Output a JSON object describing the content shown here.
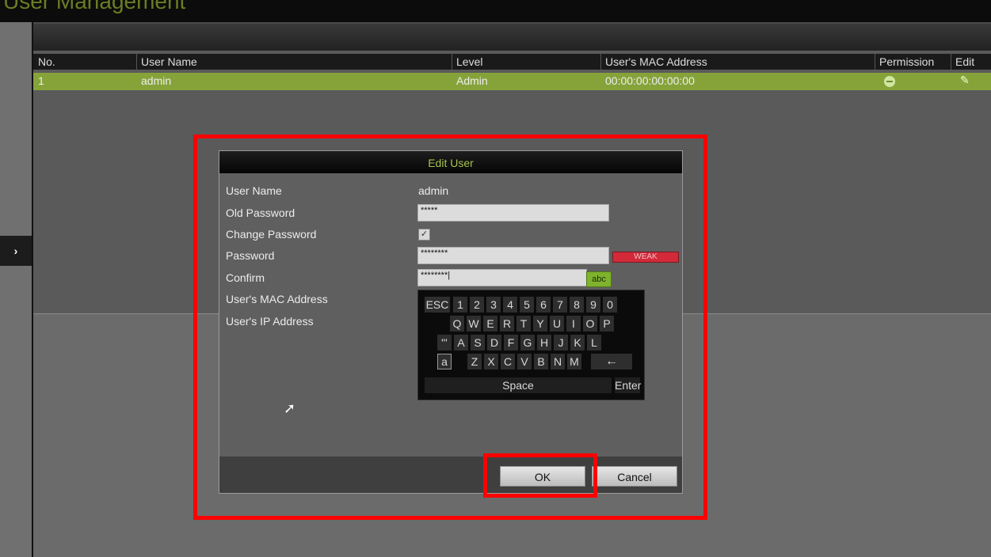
{
  "window": {
    "title": "User Management"
  },
  "sidebar": {
    "collapse_label": "›"
  },
  "table": {
    "headers": {
      "no": "No.",
      "user_name": "User Name",
      "level": "Level",
      "mac": "User's MAC Address",
      "permission": "Permission",
      "edit": "Edit"
    },
    "rows": [
      {
        "no": "1",
        "user_name": "admin",
        "level": "Admin",
        "mac": "00:00:00:00:00:00",
        "permission_icon": "minus-circle-icon",
        "edit_icon": "pencil-icon"
      }
    ]
  },
  "dialog": {
    "title": "Edit User",
    "labels": {
      "user_name": "User Name",
      "old_password": "Old Password",
      "change_password": "Change Password",
      "password": "Password",
      "confirm": "Confirm",
      "mac": "User's MAC Address",
      "ip": "User's IP Address"
    },
    "values": {
      "user_name": "admin",
      "old_password": "*****",
      "change_password_checked": true,
      "password": "********",
      "confirm": "********|"
    },
    "password_strength": "WEAK",
    "input_mode": "abc",
    "keyboard": {
      "row1": [
        "ESC",
        "1",
        "2",
        "3",
        "4",
        "5",
        "6",
        "7",
        "8",
        "9",
        "0"
      ],
      "row2": [
        "Q",
        "W",
        "E",
        "R",
        "T",
        "Y",
        "U",
        "I",
        "O",
        "P"
      ],
      "row3": [
        "\"'",
        "A",
        "S",
        "D",
        "F",
        "G",
        "H",
        "J",
        "K",
        "L"
      ],
      "row4": [
        "a",
        "Z",
        "X",
        "C",
        "V",
        "B",
        "N",
        "M",
        "←"
      ],
      "space": "Space",
      "enter": "Enter"
    },
    "ok_label": "OK",
    "cancel_label": "Cancel"
  },
  "colors": {
    "accent_green": "#86a33a",
    "highlight_red": "#ff0000",
    "weak_red": "#d32a3a"
  }
}
